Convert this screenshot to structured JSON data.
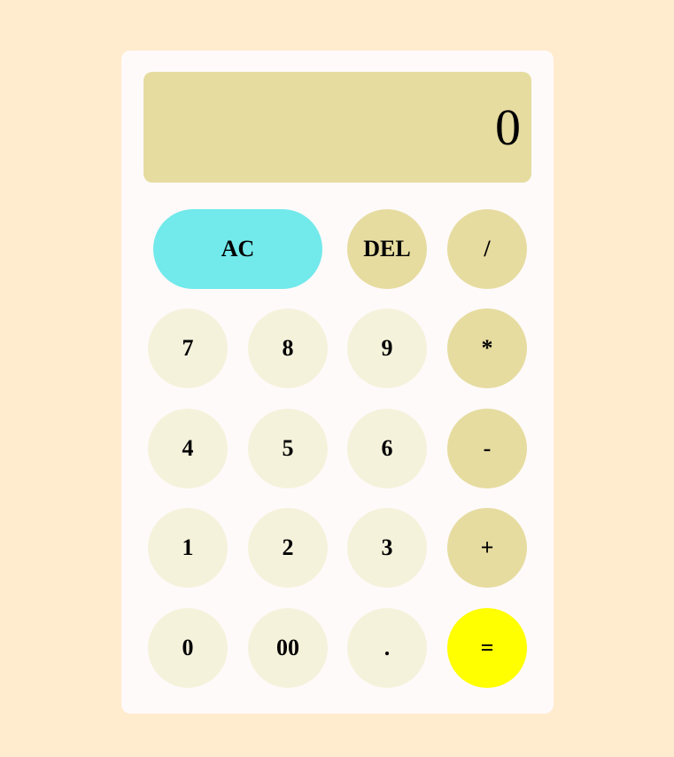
{
  "display": {
    "value": "0"
  },
  "colors": {
    "page_background": "#FFEBCD",
    "panel_background": "#FFFAFA",
    "display_background": "#E6DCA0",
    "number_button": "#F5F2DC",
    "operator_button": "#E6DCA0",
    "clear_button": "#72E9EB",
    "equals_button": "#FFFF00"
  },
  "keys": {
    "clear": "AC",
    "delete": "DEL",
    "divide": "/",
    "multiply": "*",
    "subtract": "-",
    "add": "+",
    "equals": "=",
    "seven": "7",
    "eight": "8",
    "nine": "9",
    "four": "4",
    "five": "5",
    "six": "6",
    "one": "1",
    "two": "2",
    "three": "3",
    "zero": "0",
    "double_zero": "00",
    "decimal": "."
  }
}
